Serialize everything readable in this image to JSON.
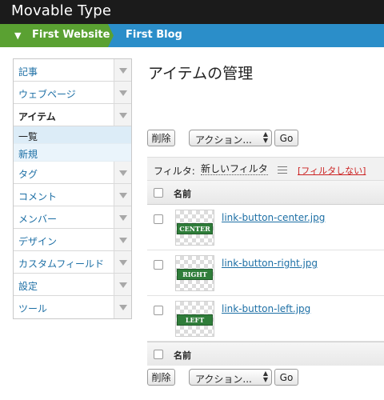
{
  "app": {
    "title": "Movable Type"
  },
  "breadcrumb": {
    "website": "First Website",
    "blog": "First Blog"
  },
  "sidebar": {
    "items": [
      {
        "label": "記事"
      },
      {
        "label": "ウェブページ"
      },
      {
        "label": "アイテム"
      },
      {
        "label": "タグ"
      },
      {
        "label": "コメント"
      },
      {
        "label": "メンバー"
      },
      {
        "label": "デザイン"
      },
      {
        "label": "カスタムフィールド"
      },
      {
        "label": "設定"
      },
      {
        "label": "ツール"
      }
    ],
    "subitems": [
      {
        "label": "一覧"
      },
      {
        "label": "新規"
      }
    ]
  },
  "main": {
    "title": "アイテムの管理",
    "toolbar": {
      "delete_label": "削除",
      "action_label": "アクション...",
      "go_label": "Go"
    },
    "filter": {
      "label": "フィルタ:",
      "value": "新しいフィルタ",
      "none_label": "[フィルタしない]"
    },
    "table": {
      "header": "名前",
      "rows": [
        {
          "filename": "link-button-center.jpg",
          "thumb_text": "CENTER"
        },
        {
          "filename": "link-button-right.jpg",
          "thumb_text": "RIGHT"
        },
        {
          "filename": "link-button-left.jpg",
          "thumb_text": "LEFT"
        }
      ]
    }
  }
}
